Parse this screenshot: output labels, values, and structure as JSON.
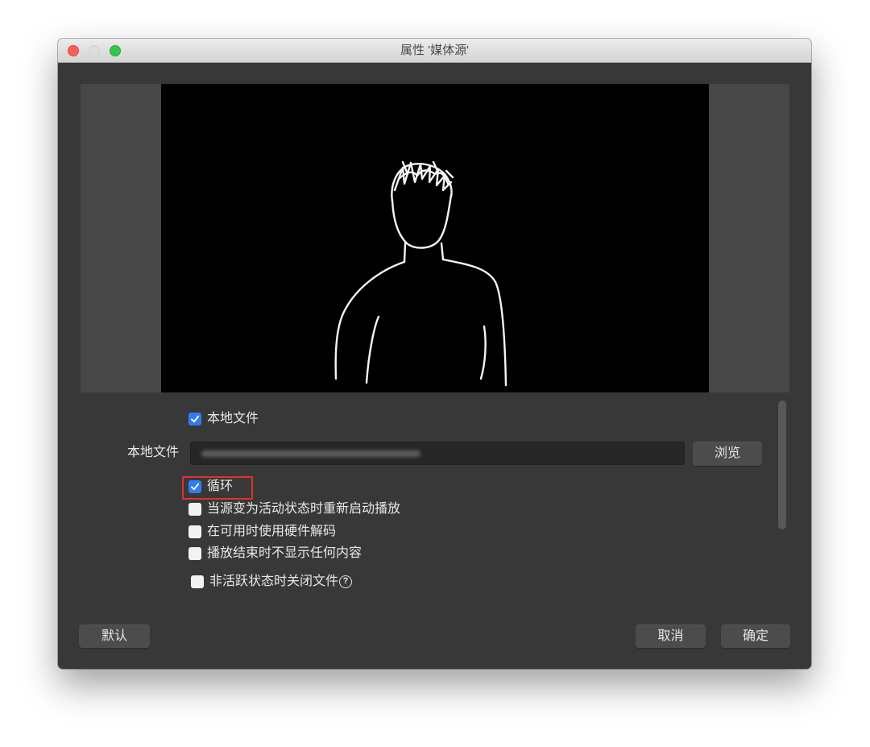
{
  "window": {
    "title": "属性 '媒体源'"
  },
  "properties": {
    "local_file_checkbox": {
      "label": "本地文件",
      "checked": true
    },
    "local_file_field": {
      "label": "本地文件",
      "browse_label": "浏览"
    },
    "options": [
      {
        "label": "循环",
        "checked": true,
        "highlighted": true
      },
      {
        "label": "当源变为活动状态时重新启动播放",
        "checked": false
      },
      {
        "label": "在可用时使用硬件解码",
        "checked": false
      },
      {
        "label": "播放结束时不显示任何内容",
        "checked": false
      },
      {
        "label": "非活跃状态时关闭文件",
        "checked": false,
        "help_glyph": "?"
      }
    ]
  },
  "footer": {
    "defaults_label": "默认",
    "cancel_label": "取消",
    "ok_label": "确定"
  },
  "colors": {
    "accent": "#2f7cf6",
    "highlight": "#e0322b",
    "window_bg": "#383838"
  },
  "icons": {
    "checkbox_check": "checkmark-icon",
    "help": "help-circle-icon",
    "close": "close-button",
    "zoom": "zoom-button"
  }
}
